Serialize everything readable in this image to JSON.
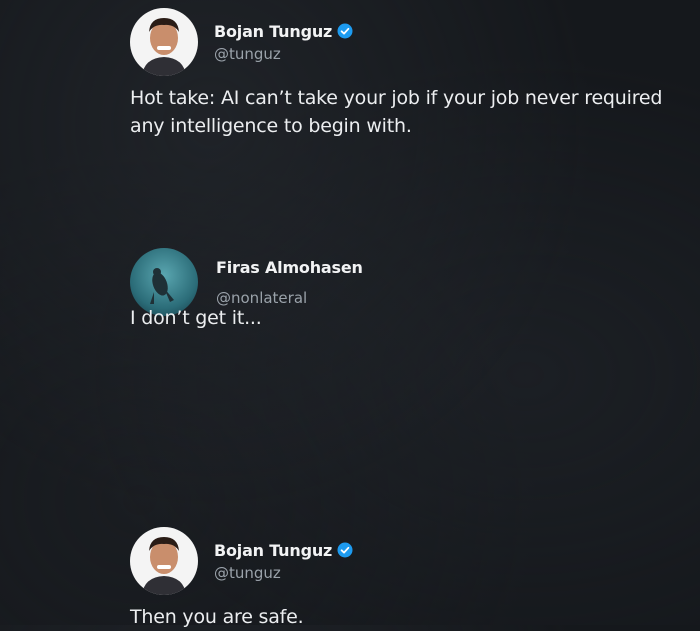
{
  "tweets": [
    {
      "author": "Bojan Tunguz",
      "handle": "@tunguz",
      "verified": true,
      "text": "Hot take: AI can’t take your job if your job never required any intelligence to begin with."
    },
    {
      "author": "Firas Almohasen",
      "handle": "@nonlateral",
      "verified": false,
      "text": "I don’t get it..."
    },
    {
      "author": "Bojan Tunguz",
      "handle": "@tunguz",
      "verified": true,
      "text": "Then you are safe."
    }
  ],
  "colors": {
    "background": "#15181c",
    "verified_badge": "#1d9bf0",
    "handle": "#9aa2aa",
    "text": "#eceef0"
  }
}
